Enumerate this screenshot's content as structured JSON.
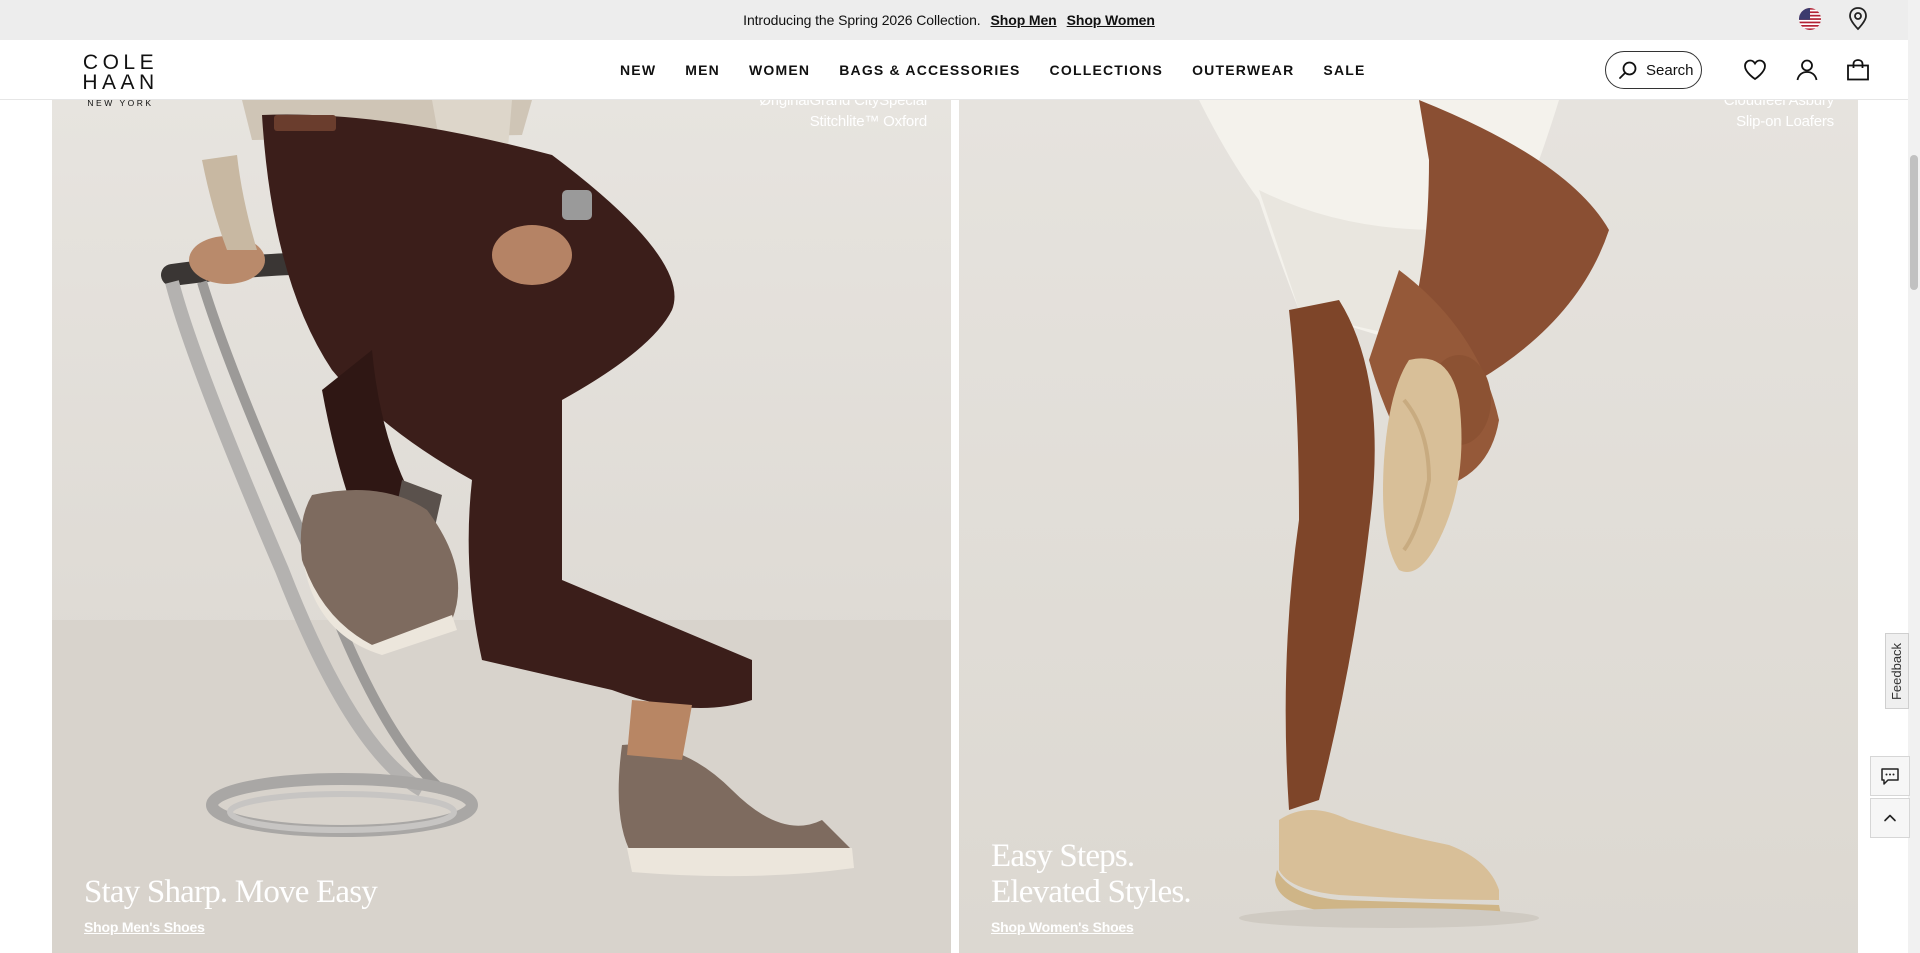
{
  "promo": {
    "text": "Introducing the Spring 2026 Collection.",
    "shop_men": "Shop Men",
    "shop_women": "Shop Women"
  },
  "header": {
    "logo_main": "COLE HAAN",
    "logo_sub": "NEW YORK",
    "nav": [
      "NEW",
      "MEN",
      "WOMEN",
      "BAGS & ACCESSORIES",
      "COLLECTIONS",
      "OUTERWEAR",
      "SALE"
    ],
    "search_label": "Search"
  },
  "hero": {
    "left": {
      "caption_line1": "ØriginalGrand CitySpecial",
      "caption_line2": "Stitchlite™ Oxford",
      "headline": "Stay Sharp. Move Easy",
      "link": "Shop Men's Shoes"
    },
    "right": {
      "caption_line1": "Cloudfeel Asbury",
      "caption_line2": "Slip-on Loafers",
      "headline_line1": "Easy Steps.",
      "headline_line2": "Elevated Styles.",
      "link": "Shop Women's Shoes"
    }
  },
  "widgets": {
    "feedback": "Feedback"
  },
  "colors": {
    "promo_bg": "#ededed",
    "panel_bg": "#e4e1dc",
    "headline_text": "#ffffff"
  }
}
